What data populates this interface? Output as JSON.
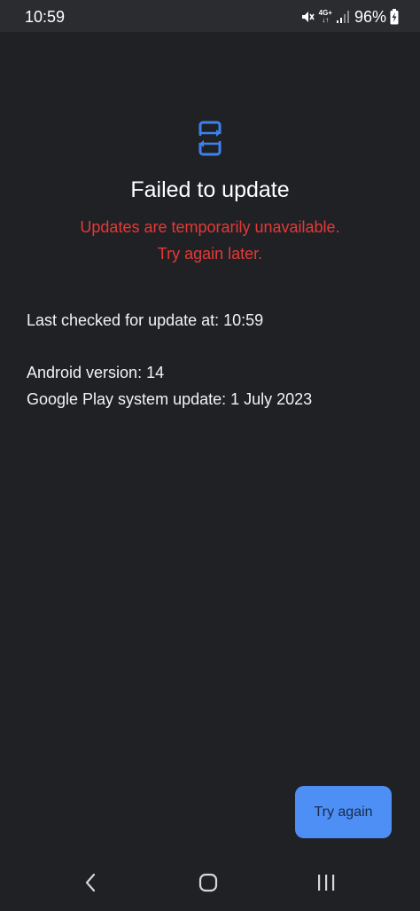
{
  "status_bar": {
    "time": "10:59",
    "network_top": "4G+",
    "network_bottom": "↓↑",
    "battery": "96%",
    "icons": [
      "mute-icon",
      "network-4g-icon",
      "signal-icon",
      "battery-charging-icon"
    ]
  },
  "main": {
    "icon": "phone-update-icon",
    "title": "Failed to update",
    "error_line1": "Updates are temporarily unavailable.",
    "error_line2": "Try again later.",
    "last_checked": "Last checked for update at: 10:59",
    "android_version": "Android version: 14",
    "play_update": "Google Play system update: 1 July 2023"
  },
  "actions": {
    "try_again": "Try again"
  },
  "nav": {
    "icons": [
      "back-icon",
      "home-icon",
      "recents-icon"
    ]
  },
  "colors": {
    "background": "#202125",
    "status_bar": "#2b2c30",
    "error": "#e53935",
    "accent": "#4d8ff5",
    "icon_blue": "#3b82f0"
  }
}
